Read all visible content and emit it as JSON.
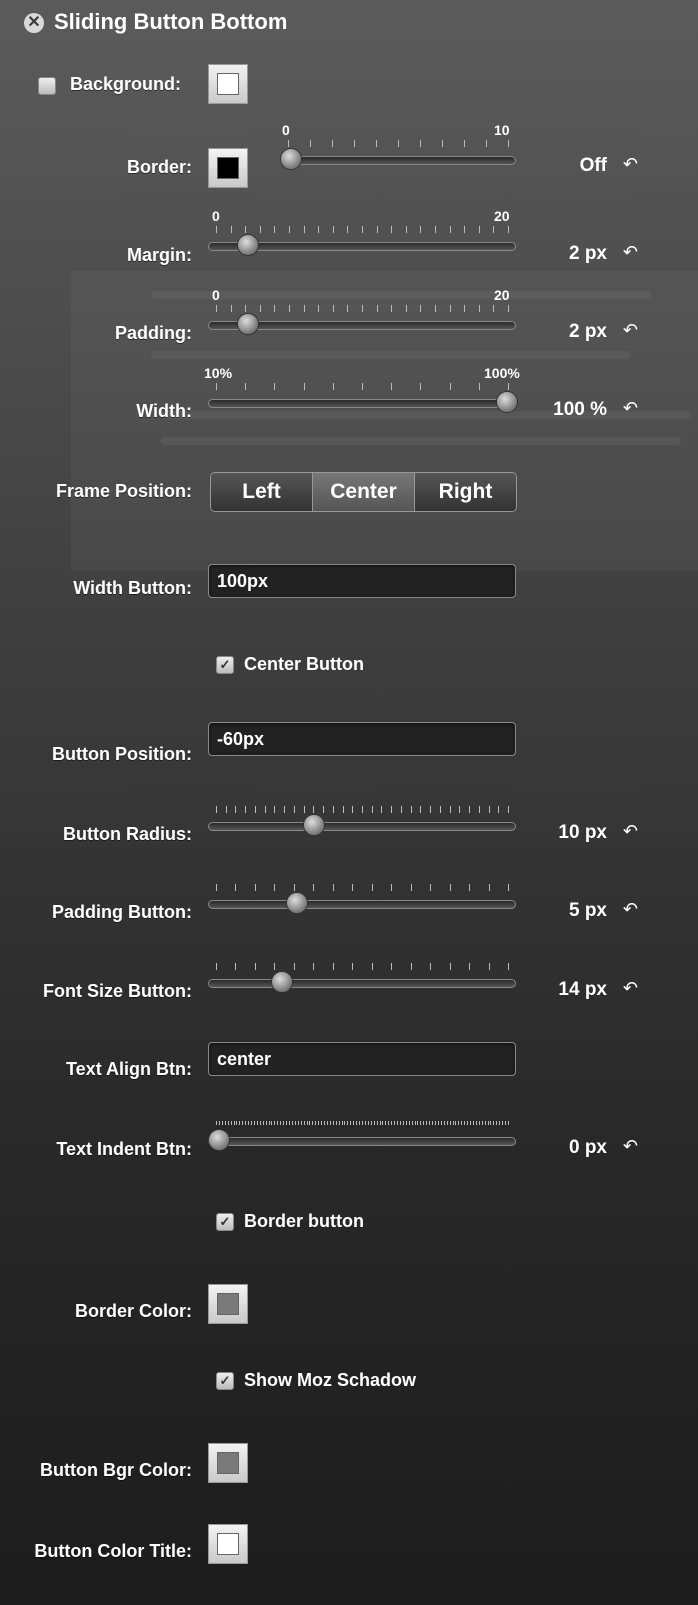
{
  "panel": {
    "title": "Sliding Button Bottom",
    "close_icon": "close-icon"
  },
  "background": {
    "label": "Background:",
    "checked": false,
    "swatch_color": "#ffffff"
  },
  "border": {
    "label": "Border:",
    "swatch_color": "#000000",
    "min": "0",
    "max": "10",
    "value": "Off",
    "level": 0
  },
  "margin": {
    "label": "Margin:",
    "min": "0",
    "max": "20",
    "value": "2 px",
    "level": 0.1
  },
  "padding": {
    "label": "Padding:",
    "min": "0",
    "max": "20",
    "value": "2 px",
    "level": 0.1
  },
  "width": {
    "label": "Width:",
    "min": "10%",
    "max": "100%",
    "value": "100 %",
    "level": 1.0
  },
  "frame_position": {
    "label": "Frame Position:",
    "options": [
      "Left",
      "Center",
      "Right"
    ],
    "selected": "Center"
  },
  "width_button": {
    "label": "Width Button:",
    "value": "100px"
  },
  "center_button": {
    "label": "Center Button",
    "checked": true
  },
  "button_position": {
    "label": "Button Position:",
    "value": "-60px"
  },
  "button_radius": {
    "label": "Button Radius:",
    "value": "10 px",
    "level": 0.33
  },
  "padding_button": {
    "label": "Padding Button:",
    "value": "5 px",
    "level": 0.27
  },
  "font_size_button": {
    "label": "Font Size Button:",
    "value": "14 px",
    "level": 0.22
  },
  "text_align_btn": {
    "label": "Text Align Btn:",
    "value": "center"
  },
  "text_indent_btn": {
    "label": "Text Indent Btn:",
    "value": "0 px",
    "level": 0
  },
  "border_button": {
    "label": "Border button",
    "checked": true
  },
  "border_color": {
    "label": "Border Color:",
    "swatch_color": "#7a7a7a"
  },
  "show_moz_shadow": {
    "label": "Show Moz Schadow",
    "checked": true
  },
  "button_bgr_color": {
    "label": "Button Bgr Color:",
    "swatch_color": "#7a7a7a"
  },
  "button_color_title": {
    "label": "Button Color Title:",
    "swatch_color": "#ffffff"
  },
  "reset_icon": "undo-arrow-icon"
}
